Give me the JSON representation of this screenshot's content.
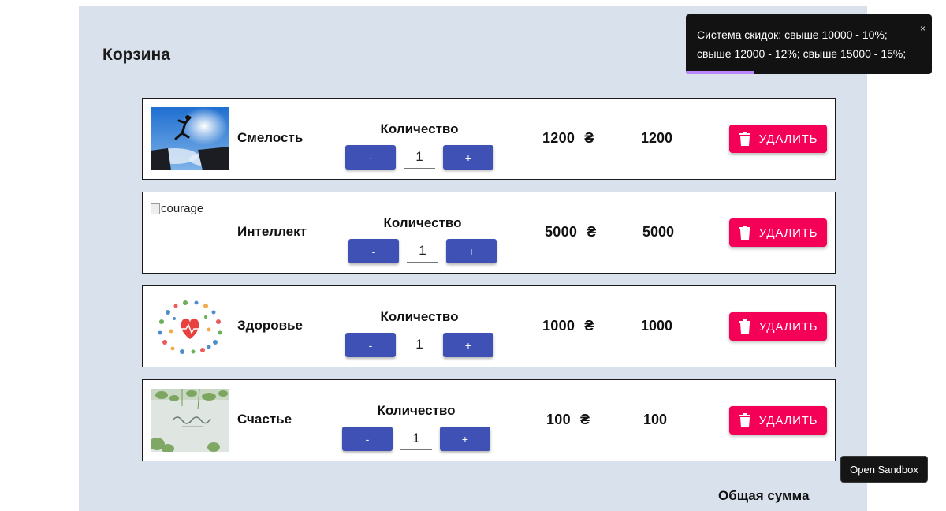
{
  "cart": {
    "title": "Корзина",
    "qty_label": "Количество",
    "minus_label": "-",
    "plus_label": "+",
    "delete_label": "УДАЛИТЬ",
    "currency_symbol": "₴",
    "total_caption": "Общая сумма",
    "items": [
      {
        "name": "Смелость",
        "quantity": "1",
        "price": "1200",
        "line_total": "1200",
        "image": "cliff-jumper-photo"
      },
      {
        "name": "Интеллект",
        "quantity": "1",
        "price": "5000",
        "line_total": "5000",
        "image_alt": "courage"
      },
      {
        "name": "Здоровье",
        "quantity": "1",
        "price": "1000",
        "line_total": "1000",
        "image": "health-icons-illustration"
      },
      {
        "name": "Счастье",
        "quantity": "1",
        "price": "100",
        "line_total": "100",
        "image": "happiness-sign-photo"
      }
    ]
  },
  "toast": {
    "message": "Система скидок: свыше 10000 - 10%; свыше 12000 - 12%; свыше 15000 - 15%;",
    "close_label": "×",
    "progress": 0.28
  },
  "sandbox_button": {
    "label": "Open Sandbox"
  },
  "colors": {
    "panel_bg": "#d8e1ec",
    "qty_button": "#3f51b5",
    "delete_button": "#f50057",
    "toast_bg": "#121212",
    "toast_progress": "#bb86fc"
  }
}
